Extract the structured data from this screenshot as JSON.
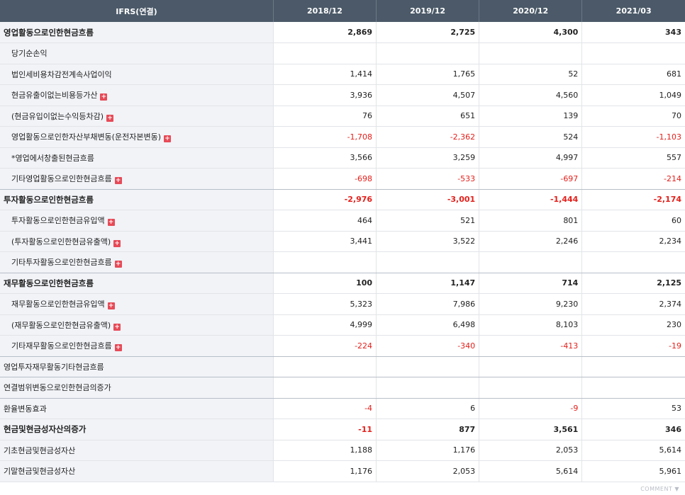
{
  "header": {
    "label": "IFRS(연결)",
    "periods": [
      "2018/12",
      "2019/12",
      "2020/12",
      "2021/03"
    ]
  },
  "rows": [
    {
      "label": "영업활동으로인한현금흐름",
      "values": [
        "2,869",
        "2,725",
        "4,300",
        "343"
      ]
    },
    {
      "label": "당기순손익",
      "values": [
        "",
        "",
        "",
        ""
      ]
    },
    {
      "label": "법인세비용차감전계속사업이익",
      "values": [
        "1,414",
        "1,765",
        "52",
        "681"
      ]
    },
    {
      "label": "현금유출이없는비용등가산",
      "values": [
        "3,936",
        "4,507",
        "4,560",
        "1,049"
      ]
    },
    {
      "label": "(현금유입이없는수익등차감)",
      "values": [
        "76",
        "651",
        "139",
        "70"
      ]
    },
    {
      "label": "영업활동으로인한자산부채변동(운전자본변동)",
      "values": [
        "-1,708",
        "-2,362",
        "524",
        "-1,103"
      ]
    },
    {
      "label": "*영업에서창출된현금흐름",
      "values": [
        "3,566",
        "3,259",
        "4,997",
        "557"
      ]
    },
    {
      "label": "기타영업활동으로인한현금흐름",
      "values": [
        "-698",
        "-533",
        "-697",
        "-214"
      ]
    },
    {
      "label": "투자활동으로인한현금흐름",
      "values": [
        "-2,976",
        "-3,001",
        "-1,444",
        "-2,174"
      ]
    },
    {
      "label": "투자활동으로인한현금유입액",
      "values": [
        "464",
        "521",
        "801",
        "60"
      ]
    },
    {
      "label": "(투자활동으로인한현금유출액)",
      "values": [
        "3,441",
        "3,522",
        "2,246",
        "2,234"
      ]
    },
    {
      "label": "기타투자활동으로인한현금흐름",
      "values": [
        "",
        "",
        "",
        ""
      ]
    },
    {
      "label": "재무활동으로인한현금흐름",
      "values": [
        "100",
        "1,147",
        "714",
        "2,125"
      ]
    },
    {
      "label": "재무활동으로인한현금유입액",
      "values": [
        "5,323",
        "7,986",
        "9,230",
        "2,374"
      ]
    },
    {
      "label": "(재무활동으로인한현금유출액)",
      "values": [
        "4,999",
        "6,498",
        "8,103",
        "230"
      ]
    },
    {
      "label": "기타재무활동으로인한현금흐름",
      "values": [
        "-224",
        "-340",
        "-413",
        "-19"
      ]
    },
    {
      "label": "영업투자재무활동기타현금흐름",
      "values": [
        "",
        "",
        "",
        ""
      ]
    },
    {
      "label": "연결범위변동으로인한현금의증가",
      "values": [
        "",
        "",
        "",
        ""
      ]
    },
    {
      "label": "환율변동효과",
      "values": [
        "-4",
        "6",
        "-9",
        "53"
      ]
    },
    {
      "label": "현금및현금성자산의증가",
      "values": [
        "-11",
        "877",
        "3,561",
        "346"
      ]
    },
    {
      "label": "기초현금및현금성자산",
      "values": [
        "1,188",
        "1,176",
        "2,053",
        "5,614"
      ]
    },
    {
      "label": "기말현금및현금성자산",
      "values": [
        "1,176",
        "2,053",
        "5,614",
        "5,961"
      ]
    }
  ],
  "expand_icon": "plus-icon",
  "footer": {
    "comment_label": "COMMENT",
    "comment_icon": "triangle-down-icon"
  },
  "colors": {
    "header_bg": "#4b5968",
    "negative": "#e3201b",
    "expand_icon": "#e74a57",
    "label_bg": "#f1f3f7"
  }
}
